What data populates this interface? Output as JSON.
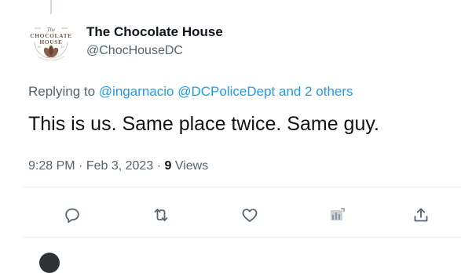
{
  "tweet": {
    "author": {
      "display_name": "The Chocolate House",
      "handle": "@ChocHouseDC",
      "avatar": {
        "logo_line_top": "The",
        "logo_line_1": "CHOCOLATE",
        "logo_line_2": "HOUSE"
      }
    },
    "replying": {
      "prefix": "Replying to",
      "mention_1": "@ingarnacio",
      "mention_2": "@DCPoliceDept",
      "suffix": "and 2 others"
    },
    "text": "This is us. Same place twice. Same guy.",
    "meta": {
      "time": "9:28 PM",
      "separator": "·",
      "date": "Feb 3, 2023",
      "views_count": "9",
      "views_label": "Views"
    }
  },
  "actions": [
    {
      "name": "reply-icon"
    },
    {
      "name": "retweet-icon"
    },
    {
      "name": "like-icon"
    },
    {
      "name": "analytics-icon"
    },
    {
      "name": "share-icon"
    }
  ],
  "colors": {
    "text_primary": "#0f1419",
    "text_secondary": "#536471",
    "link": "#1d9bf0",
    "divider": "#eff3f4",
    "logo_brown": "#7a5a48"
  }
}
